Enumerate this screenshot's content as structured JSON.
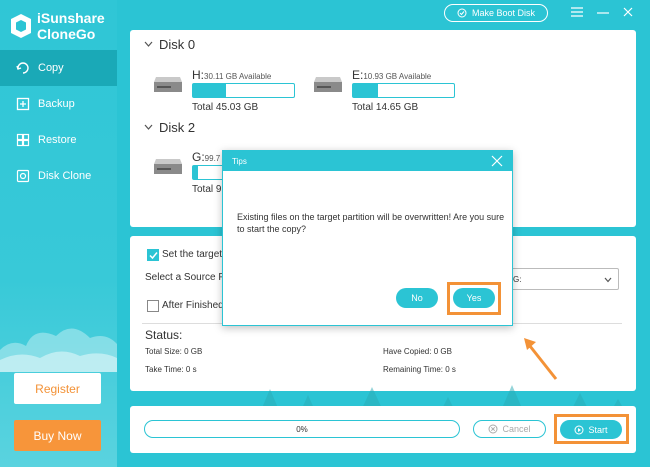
{
  "brand": {
    "line1": "iSunshare",
    "line2": "CloneGo"
  },
  "nav": [
    {
      "label": "Copy",
      "icon": "copy-icon",
      "active": true
    },
    {
      "label": "Backup",
      "icon": "backup-icon",
      "active": false
    },
    {
      "label": "Restore",
      "icon": "restore-icon",
      "active": false
    },
    {
      "label": "Disk Clone",
      "icon": "disk-clone-icon",
      "active": false
    }
  ],
  "sidebar": {
    "register_label": "Register",
    "buy_label": "Buy Now"
  },
  "titlebar": {
    "boot_label": "Make Boot Disk"
  },
  "disks": {
    "disk0": {
      "title": "Disk 0",
      "partitions": [
        {
          "letter": "H:",
          "available": "30.11 GB Available",
          "total": "Total 45.03 GB",
          "used_fraction": 0.33
        },
        {
          "letter": "E:",
          "available": "10.93 GB Available",
          "total": "Total 14.65 GB",
          "used_fraction": 0.25
        }
      ]
    },
    "disk2": {
      "title": "Disk 2",
      "partitions": [
        {
          "letter": "G:",
          "available": "99.7",
          "total": "Total 9",
          "used_fraction": 0.05
        }
      ]
    }
  },
  "options": {
    "set_target_label": "Set the target",
    "select_source_label": "Select a Source P",
    "target_select_value": "G:",
    "after_finished_label": "After Finished"
  },
  "status": {
    "title": "Status:",
    "total_size": "Total Size: 0 GB",
    "have_copied": "Have Copied: 0 GB",
    "take_time": "Take Time: 0 s",
    "remaining_time": "Remaining Time: 0 s"
  },
  "bottom": {
    "progress_text": "0%",
    "cancel_label": "Cancel",
    "start_label": "Start"
  },
  "dialog": {
    "title": "Tips",
    "message": "Existing files on the target partition will be overwritten! Are you sure to start the copy?",
    "no_label": "No",
    "yes_label": "Yes"
  },
  "colors": {
    "accent": "#2bc4d4",
    "highlight": "#f39237",
    "nav_active": "#1aa9b7"
  }
}
